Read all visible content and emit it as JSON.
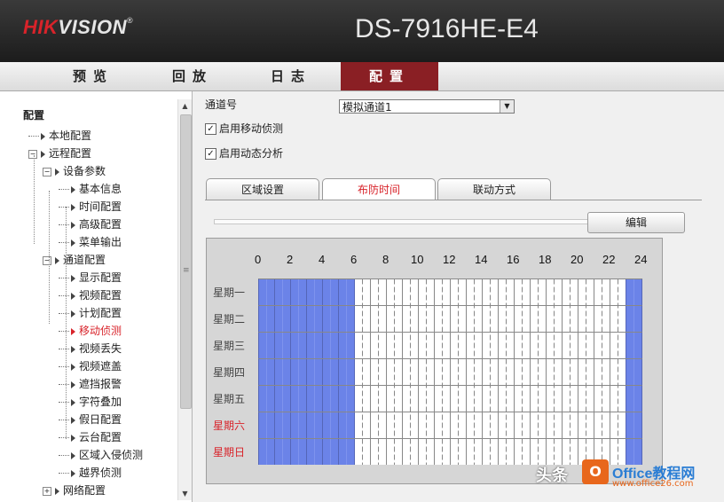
{
  "header": {
    "logo_hik": "HIK",
    "logo_vision": "VISION",
    "logo_tm": "®",
    "model": "DS-7916HE-E4"
  },
  "nav": {
    "tabs": [
      {
        "label": "预览",
        "active": false
      },
      {
        "label": "回放",
        "active": false
      },
      {
        "label": "日志",
        "active": false
      },
      {
        "label": "配置",
        "active": true
      }
    ]
  },
  "sidebar": {
    "title": "配置",
    "tree": [
      {
        "label": "本地配置",
        "level": 0,
        "expander": "none"
      },
      {
        "label": "远程配置",
        "level": 0,
        "expander": "−"
      },
      {
        "label": "设备参数",
        "level": 1,
        "expander": "−"
      },
      {
        "label": "基本信息",
        "level": 2
      },
      {
        "label": "时间配置",
        "level": 2
      },
      {
        "label": "高级配置",
        "level": 2
      },
      {
        "label": "菜单输出",
        "level": 2
      },
      {
        "label": "通道配置",
        "level": 1,
        "expander": "−"
      },
      {
        "label": "显示配置",
        "level": 2
      },
      {
        "label": "视频配置",
        "level": 2
      },
      {
        "label": "计划配置",
        "level": 2
      },
      {
        "label": "移动侦测",
        "level": 2,
        "active": true
      },
      {
        "label": "视频丢失",
        "level": 2
      },
      {
        "label": "视频遮盖",
        "level": 2
      },
      {
        "label": "遮挡报警",
        "level": 2
      },
      {
        "label": "字符叠加",
        "level": 2
      },
      {
        "label": "假日配置",
        "level": 2
      },
      {
        "label": "云台配置",
        "level": 2
      },
      {
        "label": "区域入侵侦测",
        "level": 2
      },
      {
        "label": "越界侦测",
        "level": 2
      },
      {
        "label": "网络配置",
        "level": 1,
        "expander": "+"
      }
    ]
  },
  "main": {
    "channel_label": "通道号",
    "channel_value": "模拟通道1",
    "enable_motion_label": "启用移动侦测",
    "enable_motion_checked": true,
    "enable_dynamic_label": "启用动态分析",
    "enable_dynamic_checked": true,
    "subtabs": [
      {
        "label": "区域设置",
        "active": false
      },
      {
        "label": "布防时间",
        "active": true
      },
      {
        "label": "联动方式",
        "active": false
      }
    ],
    "edit_label": "编辑"
  },
  "schedule": {
    "hour_labels": [
      "0",
      "2",
      "4",
      "6",
      "8",
      "10",
      "12",
      "14",
      "16",
      "18",
      "20",
      "22",
      "24"
    ],
    "days": [
      {
        "label": "星期一",
        "weekend": false
      },
      {
        "label": "星期二",
        "weekend": false
      },
      {
        "label": "星期三",
        "weekend": false
      },
      {
        "label": "星期四",
        "weekend": false
      },
      {
        "label": "星期五",
        "weekend": false
      },
      {
        "label": "星期六",
        "weekend": true
      },
      {
        "label": "星期日",
        "weekend": true
      }
    ],
    "armed_hours": [
      [
        0,
        6
      ],
      [
        23,
        24
      ]
    ],
    "armed_color": "#6b83e8",
    "unarmed_color": "#ffffff",
    "weekend_label_color": "#d8232a"
  },
  "watermark": {
    "toutiao": "头条",
    "logo": "O",
    "site": "Office教程网",
    "url": "www.office26.com"
  }
}
